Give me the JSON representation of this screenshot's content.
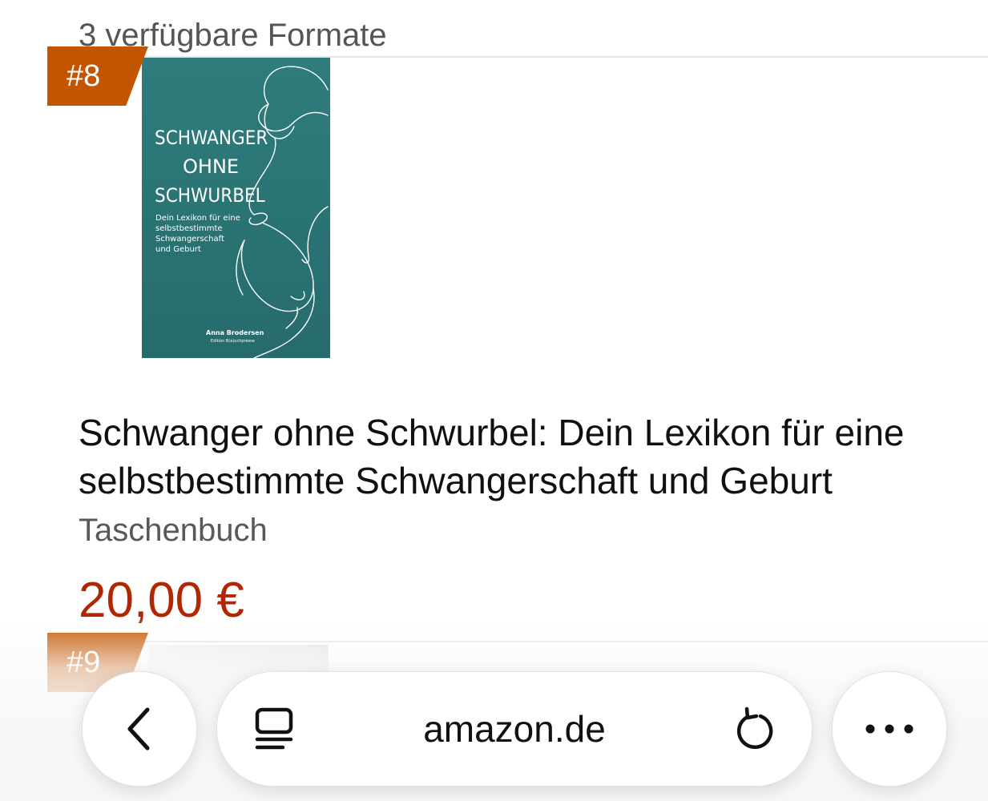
{
  "formats_label": "3 verfügbare Formate",
  "items": [
    {
      "rank": "#8",
      "title": "Schwanger ohne Schwurbel: Dein Lexikon für eine selbstbestimmte Schwangerschaft und Geburt",
      "format": "Taschenbuch",
      "price": "20,00 €",
      "cover": {
        "title_line1": "SCHWANGER",
        "title_line2": "OHNE",
        "title_line3": "SCHWURBEL",
        "subtitle_line1": "Dein Lexikon für eine",
        "subtitle_line2": "selbstbestimmte",
        "subtitle_line3": "Schwangerschaft",
        "subtitle_line4": "und Geburt",
        "author": "Anna Brodersen",
        "publisher": "Edition B(a)uchpresse",
        "background_color": "#2b7676"
      }
    },
    {
      "rank": "#9"
    }
  ],
  "browser": {
    "url": "amazon.de",
    "back_icon": "chevron-left-icon",
    "reader_icon": "reader-mode-icon",
    "reload_icon": "reload-icon",
    "more_icon": "more-dots-icon"
  },
  "colors": {
    "badge": "#c45500",
    "price": "#b12704"
  }
}
